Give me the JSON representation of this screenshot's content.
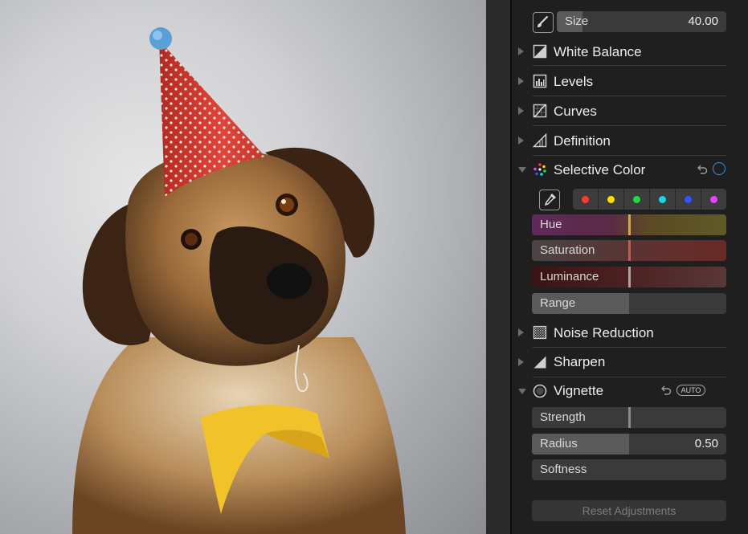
{
  "brush": {
    "size_label": "Size",
    "size_value": "40.00",
    "size_fill": 0.15
  },
  "sections": [
    {
      "key": "white-balance",
      "label": "White Balance",
      "icon": "white-balance-icon",
      "expanded": false
    },
    {
      "key": "levels",
      "label": "Levels",
      "icon": "levels-icon",
      "expanded": false
    },
    {
      "key": "curves",
      "label": "Curves",
      "icon": "curves-icon",
      "expanded": false
    },
    {
      "key": "definition",
      "label": "Definition",
      "icon": "definition-icon",
      "expanded": false
    },
    {
      "key": "selective-color",
      "label": "Selective Color",
      "icon": "selective-color-icon",
      "expanded": true
    },
    {
      "key": "noise-reduction",
      "label": "Noise Reduction",
      "icon": "noise-reduction-icon",
      "expanded": false
    },
    {
      "key": "sharpen",
      "label": "Sharpen",
      "icon": "sharpen-icon",
      "expanded": false
    },
    {
      "key": "vignette",
      "label": "Vignette",
      "icon": "vignette-icon",
      "expanded": true
    }
  ],
  "selective_color": {
    "swatches": [
      "#ff3b30",
      "#ffe000",
      "#27d83e",
      "#19d5e6",
      "#2f56ff",
      "#e445ff"
    ],
    "sliders": [
      {
        "label": "Hue",
        "level": 0.5
      },
      {
        "label": "Saturation",
        "level": 0.5
      },
      {
        "label": "Luminance",
        "level": 0.5
      },
      {
        "label": "Range",
        "level": 0.5
      }
    ]
  },
  "vignette": {
    "auto_label": "AUTO",
    "sliders": [
      {
        "label": "Strength",
        "value": "",
        "level": 0.5
      },
      {
        "label": "Radius",
        "value": "0.50",
        "level": 0.5
      },
      {
        "label": "Softness",
        "value": "",
        "level": 0.0
      }
    ]
  },
  "reset_label": "Reset Adjustments",
  "colors": {
    "panel_bg": "#1f1f1f",
    "accent_blue": "#3b8eea",
    "hat_red": "#e0453a",
    "bandana_yellow": "#f1c22a"
  }
}
